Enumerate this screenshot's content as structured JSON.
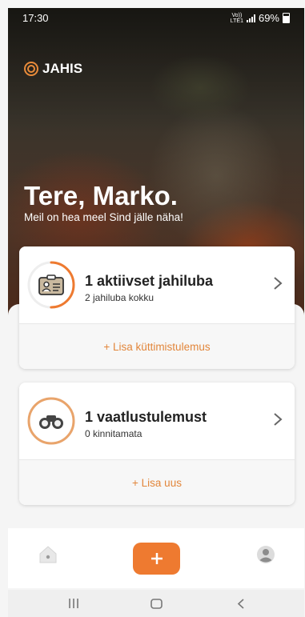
{
  "status": {
    "time": "17:30",
    "network": "Vo)) LTE1",
    "battery": "69%"
  },
  "brand": {
    "name": "JAHIS"
  },
  "greeting": {
    "title": "Tere, Marko.",
    "subtitle": "Meil on hea meel Sind jälle näha!"
  },
  "cards": [
    {
      "title": "1 aktiivset jahiluba",
      "subtitle": "2 jahiluba kokku",
      "action": "+ Lisa küttimistulemus",
      "icon": "id-card-icon",
      "progress": 0.5
    },
    {
      "title": "1 vaatlustulemust",
      "subtitle": "0 kinnitamata",
      "action": "+ Lisa uus",
      "icon": "binoculars-icon",
      "progress": 1.0
    }
  ],
  "colors": {
    "accent": "#ee7a30",
    "ring_track": "#eeeeee"
  },
  "nav": {
    "home_icon": "home-icon",
    "add_label": "+",
    "profile_icon": "profile-icon"
  },
  "system_nav": {
    "recents_icon": "recents-icon",
    "home_icon": "home-button-icon",
    "back_icon": "back-icon"
  }
}
